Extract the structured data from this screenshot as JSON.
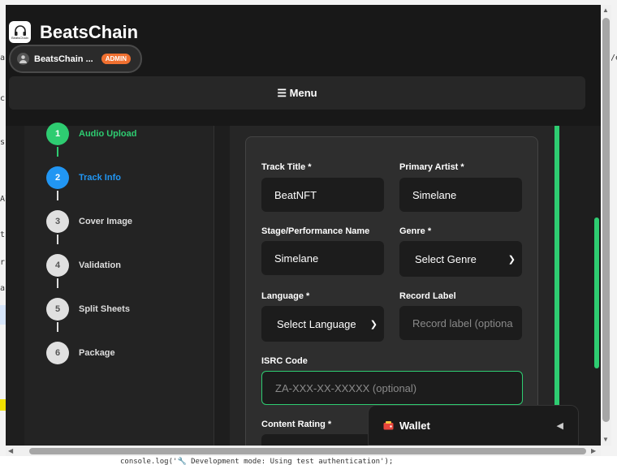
{
  "app": {
    "title": "BeatsChain",
    "logo_text": "BeatsChain"
  },
  "user": {
    "name": "BeatsChain ...",
    "badge": "ADMIN"
  },
  "menu": {
    "label": "☰ Menu"
  },
  "steps": [
    {
      "number": "1",
      "label": "Audio Upload",
      "state": "done"
    },
    {
      "number": "2",
      "label": "Track Info",
      "state": "active"
    },
    {
      "number": "3",
      "label": "Cover Image",
      "state": "pending"
    },
    {
      "number": "4",
      "label": "Validation",
      "state": "pending"
    },
    {
      "number": "5",
      "label": "Split Sheets",
      "state": "pending"
    },
    {
      "number": "6",
      "label": "Package",
      "state": "pending"
    }
  ],
  "form": {
    "track_title": {
      "label": "Track Title *",
      "value": "BeatNFT"
    },
    "primary_artist": {
      "label": "Primary Artist *",
      "value": "Simelane"
    },
    "stage_name": {
      "label": "Stage/Performance Name",
      "value": "Simelane"
    },
    "genre": {
      "label": "Genre *",
      "value": "Select Genre"
    },
    "language": {
      "label": "Language *",
      "value": "Select Language"
    },
    "record_label": {
      "label": "Record Label",
      "placeholder": "Record label (optiona"
    },
    "isrc": {
      "label": "ISRC Code",
      "placeholder": "ZA-XXX-XX-XXXXX (optional)"
    },
    "content_rating": {
      "label": "Content Rating *"
    }
  },
  "wallet": {
    "label": "Wallet",
    "toggle": "◀"
  },
  "host": {
    "code_line": "console.log('🔧 Development mode: Using test authentication');"
  },
  "colors": {
    "accent_green": "#2ecc71",
    "active_blue": "#2196f3",
    "admin_orange": "#f07030"
  }
}
